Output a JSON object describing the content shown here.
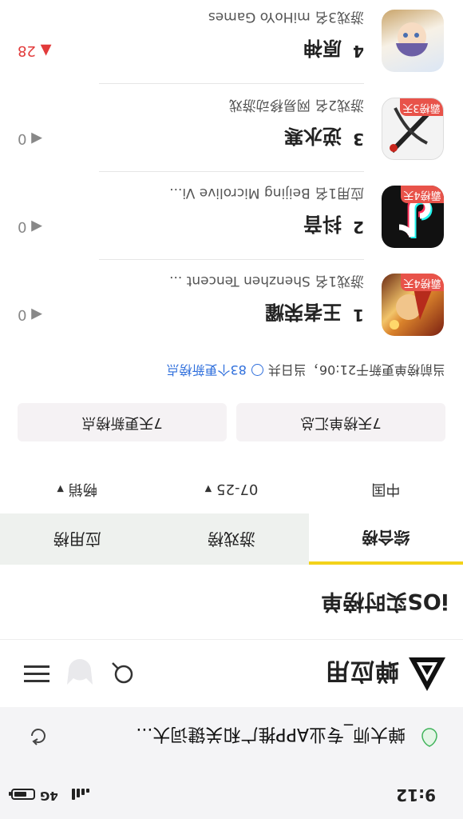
{
  "status": {
    "time": "9:12",
    "network": "4G",
    "battery_level": 0.7
  },
  "browser": {
    "url_text": "蝉大师_专业APP推广和关键词大..."
  },
  "header": {
    "brand": "蝉应用"
  },
  "page": {
    "title": "iOS实时榜单"
  },
  "tabs": [
    {
      "label": "综合榜",
      "active": true
    },
    {
      "label": "游戏榜",
      "active": false
    },
    {
      "label": "应用榜",
      "active": false
    }
  ],
  "filters": [
    {
      "label": "中国"
    },
    {
      "label": "07-25"
    },
    {
      "label": "畅销"
    }
  ],
  "actions": {
    "summary": "7天榜单汇总",
    "updates": "7天更新榜点"
  },
  "update_info": {
    "prefix": "当前榜单更新于21:06，当日共",
    "count_text": "83个更新榜点"
  },
  "rankings": [
    {
      "rank": "1",
      "name": "王者荣耀",
      "meta": "游戏1名 Shenzhen Tencent ...",
      "trend": "0",
      "trend_dir": "flat",
      "badge": "霸榜4天"
    },
    {
      "rank": "2",
      "name": "抖音",
      "meta": "应用1名 Beijing Microlive Vi...",
      "trend": "0",
      "trend_dir": "flat",
      "badge": "霸榜4天"
    },
    {
      "rank": "3",
      "name": "逆水寒",
      "meta": "游戏2名 网易移动游戏",
      "trend": "0",
      "trend_dir": "flat",
      "badge": "霸榜3天"
    },
    {
      "rank": "4",
      "name": "原神",
      "meta": "游戏3名 miHoYo Games",
      "trend": "28",
      "trend_dir": "up",
      "badge": ""
    }
  ],
  "colors": {
    "accent": "#f3d21b",
    "badge": "#e8534a",
    "link": "#2f6fdc",
    "trend_up": "#e23b3b"
  }
}
